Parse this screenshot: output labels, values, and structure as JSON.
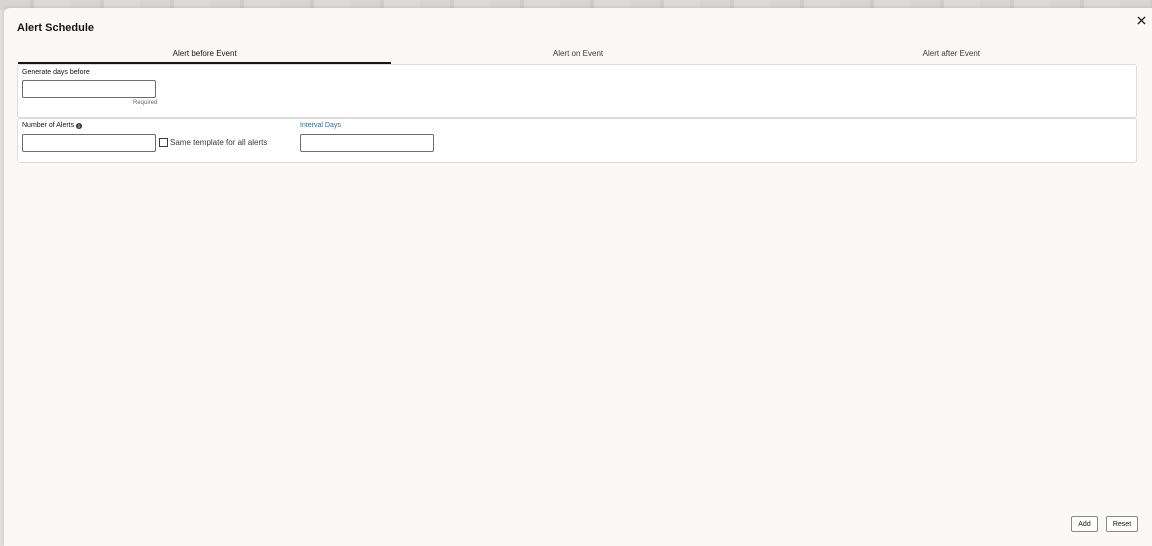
{
  "dialog": {
    "title": "Alert Schedule",
    "close_icon": "close-icon"
  },
  "tabs": [
    {
      "label": "Alert before Event",
      "active": true
    },
    {
      "label": "Alert on Event",
      "active": false
    },
    {
      "label": "Alert after Event",
      "active": false
    }
  ],
  "form": {
    "generate_days_before": {
      "label": "Generate days before",
      "value": "",
      "helper": "Required"
    },
    "number_of_alerts": {
      "label": "Number of Alerts",
      "value": "",
      "info_icon": "info-icon"
    },
    "same_template": {
      "label": "Same template for all alerts",
      "checked": false
    },
    "interval_days": {
      "label": "Interval Days",
      "value": ""
    }
  },
  "footer": {
    "add_label": "Add",
    "reset_label": "Reset"
  },
  "colors": {
    "accent_link": "#2f6d9a",
    "active_tab_underline": "#161513",
    "dialog_bg": "#fbf9f8"
  }
}
